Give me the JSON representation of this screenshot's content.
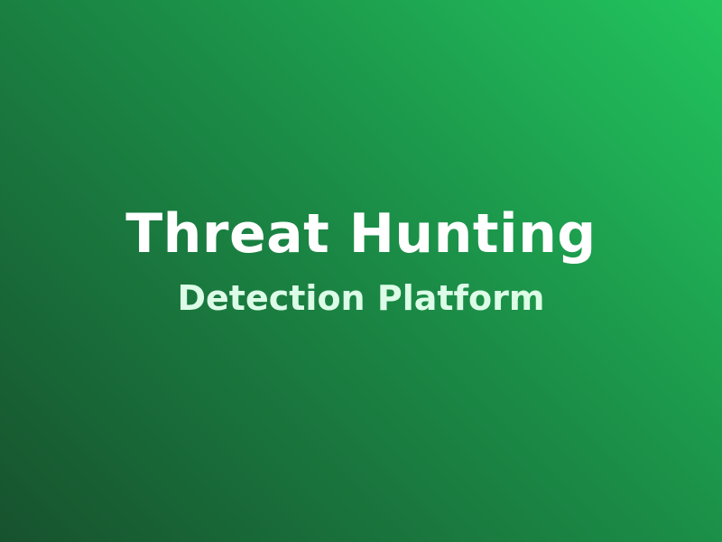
{
  "splash": {
    "title": "Threat Hunting",
    "subtitle": "Detection Platform"
  },
  "colors": {
    "gradient_light": "#22c55e",
    "gradient_mid": "#1b8d47",
    "gradient_dark": "#17522e",
    "title_text": "#ffffff",
    "subtitle_text": "#dcfce7"
  }
}
